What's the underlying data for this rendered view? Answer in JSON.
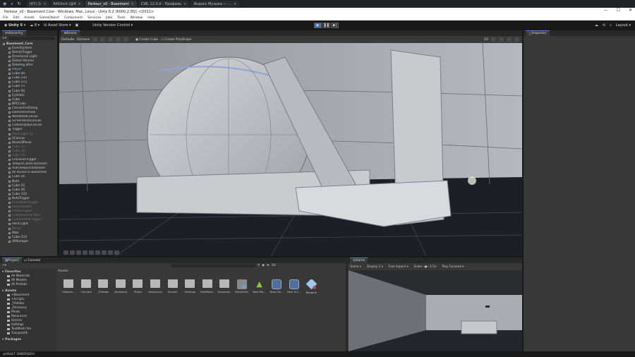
{
  "browser_tabs": [
    {
      "label": "(47) Ⓢ"
    },
    {
      "label": "641Inch (@4"
    },
    {
      "label": "Parkour_v0 - Basement",
      "active": true
    },
    {
      "label": "CWL 12.0.d - Профиль"
    },
    {
      "label": "Яндекс Музыка — ..."
    }
  ],
  "window": {
    "title": "Parkour_v0 - Basement.Core - Windows, Mac, Linux - Unity 6.2 (6000.2.0f2) <DX11>",
    "controls": [
      "—",
      "☐",
      "✕"
    ]
  },
  "menu": [
    "File",
    "Edit",
    "Assets",
    "GameObject",
    "Component",
    "Services",
    "Jobs",
    "Tools",
    "Window",
    "Help"
  ],
  "toolbar": {
    "account": "Unity 6",
    "cloud": "8",
    "asset_store": "Asset Store",
    "version_control": "Unity Version Control",
    "layout": "Layout",
    "lang": "РУС",
    "time": "10:33"
  },
  "hierarchy": {
    "title": "Hierarchy",
    "items": [
      {
        "label": "Basement_Core",
        "depth": 0,
        "root": true
      },
      {
        "label": "EventSystem",
        "depth": 1
      },
      {
        "label": "DeleteTrigger",
        "depth": 1
      },
      {
        "label": "Directional Light",
        "depth": 1
      },
      {
        "label": "Global Volume",
        "depth": 1
      },
      {
        "label": "Deleting after",
        "depth": 1
      },
      {
        "label": "Player",
        "depth": 1,
        "sel": true
      },
      {
        "label": "Cube (8)",
        "depth": 1
      },
      {
        "label": "Cube (10)",
        "depth": 1
      },
      {
        "label": "Cube (11)",
        "depth": 1
      },
      {
        "label": "Cube (7)",
        "depth": 1
      },
      {
        "label": "Cube (6)",
        "depth": 1
      },
      {
        "label": "Cylinder",
        "depth": 1
      },
      {
        "label": "Cube",
        "depth": 1
      },
      {
        "label": "NPCCube",
        "depth": 1
      },
      {
        "label": "CanvasForDialog",
        "depth": 1
      },
      {
        "label": "ElementFemale",
        "depth": 1
      },
      {
        "label": "WorldHintCanvas",
        "depth": 1
      },
      {
        "label": "ScreenHintsCanvas",
        "depth": 1
      },
      {
        "label": "CodeDisplayCanvas",
        "depth": 1
      },
      {
        "label": "Trigger",
        "depth": 1
      },
      {
        "label": "Point Light (1)",
        "depth": 1,
        "dim": true
      },
      {
        "label": "SCanvas",
        "depth": 1
      },
      {
        "label": "BlackUIPanel",
        "depth": 1
      },
      {
        "label": "Cube (1)",
        "depth": 1,
        "dim": true
      },
      {
        "label": "Cube (2)",
        "depth": 1,
        "dim": true
      },
      {
        "label": "Cube (3)",
        "depth": 1,
        "dim": true
      },
      {
        "label": "CrossExitTrigger",
        "depth": 1
      },
      {
        "label": "Teleport_BackToStream",
        "depth": 1
      },
      {
        "label": "AutoTeleportToStream",
        "depth": 1
      },
      {
        "label": "All Across In Basement",
        "depth": 1
      },
      {
        "label": "Cube (4)",
        "depth": 1
      },
      {
        "label": "Note",
        "depth": 1
      },
      {
        "label": "Cube (5)",
        "depth": 1
      },
      {
        "label": "Cube (9)",
        "depth": 1
      },
      {
        "label": "Cube (12)",
        "depth": 1
      },
      {
        "label": "NoteTrigger",
        "depth": 1
      },
      {
        "label": "FinishNoteTrigger",
        "depth": 1,
        "dim": true
      },
      {
        "label": "PhysicsDatas",
        "depth": 1,
        "dim": true
      },
      {
        "label": "PrefabTrigger",
        "depth": 1,
        "dim": true
      },
      {
        "label": "CustomEvent After",
        "depth": 1,
        "dim": true
      },
      {
        "label": "CustomAfterTrigger",
        "depth": 1,
        "dim": true
      },
      {
        "label": "Point Light",
        "depth": 1
      },
      {
        "label": "Mirror",
        "depth": 1,
        "dim": true
      },
      {
        "label": "Mob",
        "depth": 1
      },
      {
        "label": "Cube (13)",
        "depth": 1
      },
      {
        "label": "UIManager",
        "depth": 1
      }
    ]
  },
  "scene": {
    "title": "Scene",
    "tools": [
      "Default",
      "Gizmos",
      "2D"
    ],
    "create_cube": "Create Cube",
    "create_polyshape": "Create PolyShape"
  },
  "inspector": {
    "title": "Inspector"
  },
  "project": {
    "tabs": [
      "Project",
      "Console"
    ],
    "breadcrumb": "Assets",
    "tree": [
      {
        "label": "Favorites",
        "bold": true
      },
      {
        "label": "All Materials",
        "depth": 1
      },
      {
        "label": "All Models",
        "depth": 1
      },
      {
        "label": "All Prefabs",
        "depth": 1
      },
      {
        "label": "Assets",
        "bold": true,
        "gap": true
      },
      {
        "label": "+Basement",
        "depth": 1
      },
      {
        "label": "+Scripts",
        "depth": 1
      },
      {
        "label": "_Prefabs",
        "depth": 1
      },
      {
        "label": "_Recovery",
        "depth": 1
      },
      {
        "label": "Photo",
        "depth": 1
      },
      {
        "label": "Resources",
        "depth": 1
      },
      {
        "label": "Scenes",
        "depth": 1
      },
      {
        "label": "Settings",
        "depth": 1
      },
      {
        "label": "TextMesh Pro",
        "depth": 1
      },
      {
        "label": "Yusupnatik",
        "depth": 1
      },
      {
        "label": "Packages",
        "bold": true,
        "gap": true
      }
    ],
    "assets": [
      {
        "label": "+Basem...",
        "kind": "folder"
      },
      {
        "label": "+Scripts",
        "kind": "folder"
      },
      {
        "label": "_Prefabs",
        "kind": "folder"
      },
      {
        "label": "_Recovery",
        "kind": "folder"
      },
      {
        "label": "Photo",
        "kind": "folder"
      },
      {
        "label": "Resources",
        "kind": "folder"
      },
      {
        "label": "Scenes",
        "kind": "folder"
      },
      {
        "label": "Settings",
        "kind": "folder"
      },
      {
        "label": "TextMesh...",
        "kind": "folder"
      },
      {
        "label": "Yusupnat...",
        "kind": "folder"
      },
      {
        "label": "DefaultVo...",
        "kind": "volume"
      },
      {
        "label": "New Pla...",
        "kind": "android"
      },
      {
        "label": "New Uni...",
        "kind": "scene"
      },
      {
        "label": "New Uni...",
        "kind": "scene"
      },
      {
        "label": "Readme",
        "kind": "readme"
      }
    ],
    "count": "20"
  },
  "game": {
    "title": "Game",
    "display": "Game",
    "display_num": "Display 1",
    "aspect": "Free Aspect",
    "scale_label": "Scale",
    "scale": "1.5x",
    "play_focused": "Play Focused"
  },
  "status": {
    "text": "VAULT ЗАВЕРШЕН"
  }
}
